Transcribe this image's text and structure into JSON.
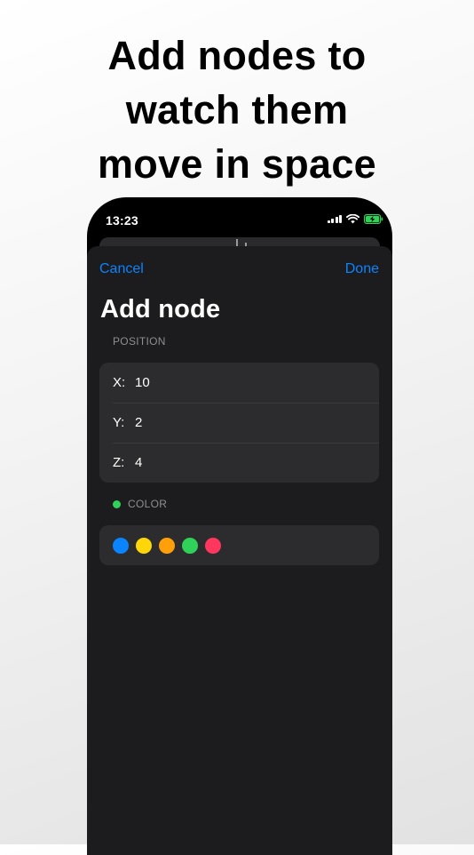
{
  "headline": {
    "lines": [
      "Add nodes to",
      "watch them",
      "move in space"
    ]
  },
  "status_bar": {
    "time": "13:23",
    "icons": [
      "cellular-signal-icon",
      "wifi-icon",
      "battery-charging-icon"
    ],
    "battery_color": "#30d158"
  },
  "sheet": {
    "cancel_label": "Cancel",
    "done_label": "Done",
    "title": "Add node",
    "accent_color": "#0a84ff",
    "position_section": {
      "label": "POSITION",
      "rows": [
        {
          "label": "X:",
          "value": "10"
        },
        {
          "label": "Y:",
          "value": "2"
        },
        {
          "label": "Z:",
          "value": "4"
        }
      ]
    },
    "color_section": {
      "label": "COLOR",
      "selected_color": "#30d158",
      "swatches": [
        {
          "name": "blue",
          "hex": "#0a84ff"
        },
        {
          "name": "yellow",
          "hex": "#ffd60a"
        },
        {
          "name": "orange",
          "hex": "#ff9f0a"
        },
        {
          "name": "green",
          "hex": "#30d158"
        },
        {
          "name": "pink",
          "hex": "#ff375f"
        }
      ]
    }
  }
}
